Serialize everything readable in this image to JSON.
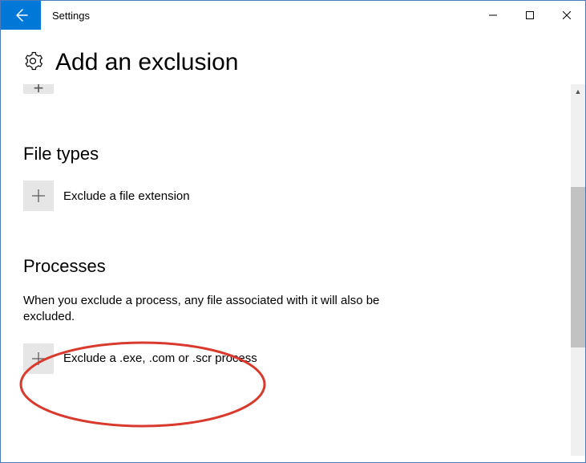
{
  "window": {
    "title": "Settings"
  },
  "header": {
    "title": "Add an exclusion"
  },
  "sections": {
    "fileTypes": {
      "heading": "File types",
      "action": "Exclude a file extension"
    },
    "processes": {
      "heading": "Processes",
      "description": "When you exclude a process, any file associated with it will also be excluded.",
      "action": "Exclude a .exe, .com or .scr process"
    }
  }
}
